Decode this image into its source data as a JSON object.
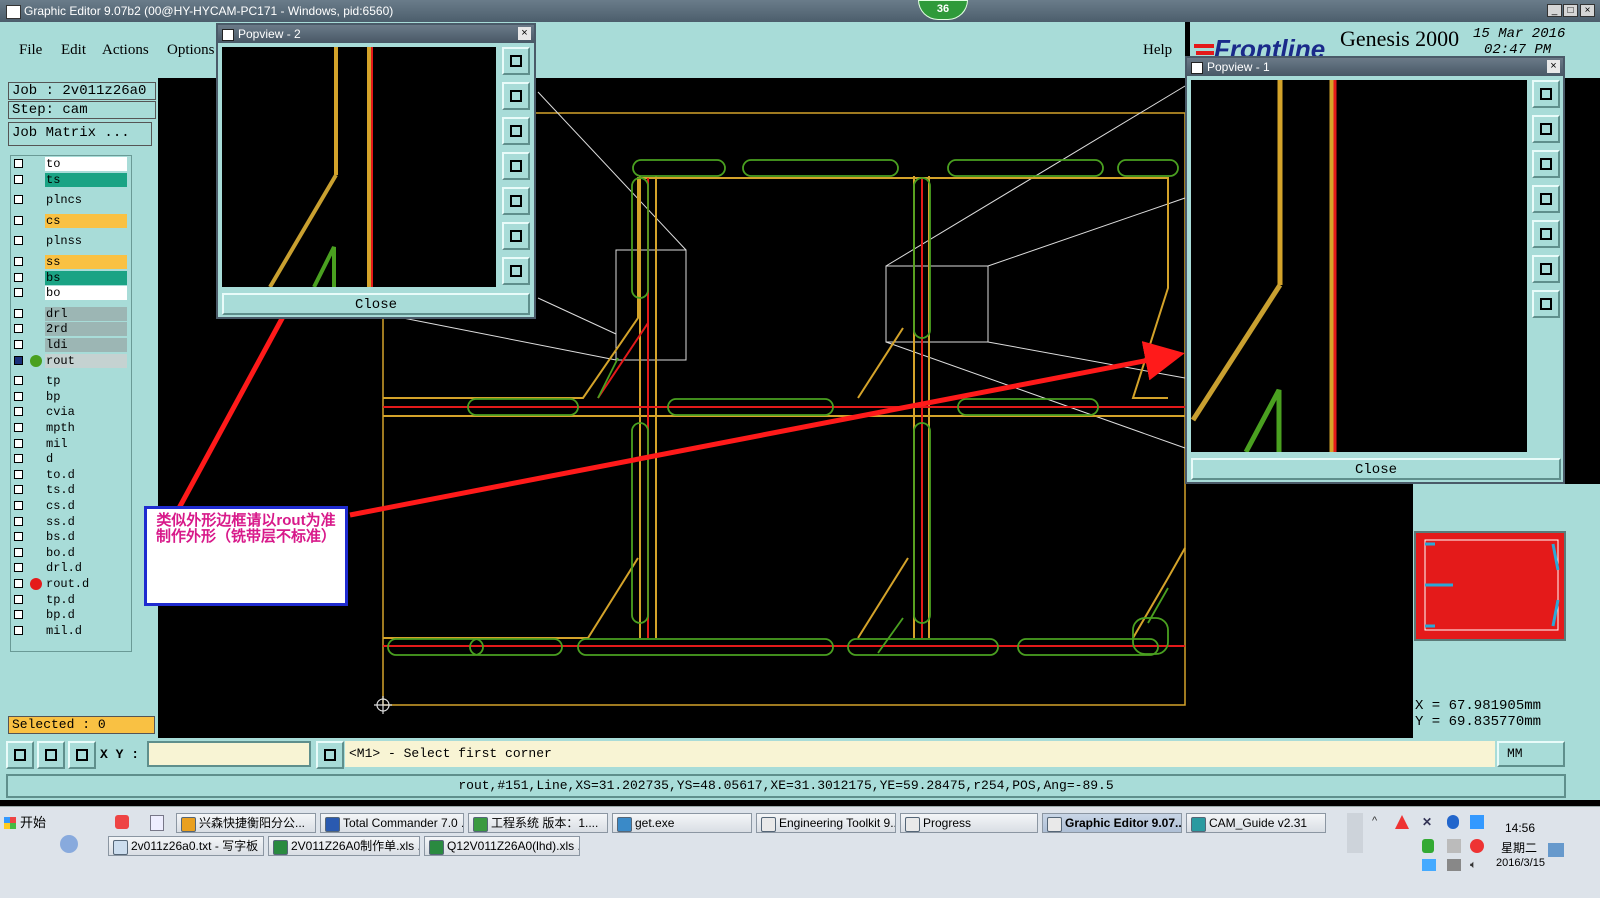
{
  "window": {
    "title": "Graphic Editor 9.07b2 (00@HY-HYCAM-PC171 - Windows, pid:6560)",
    "badge": "36",
    "min_glyph": "_",
    "max_glyph": "□",
    "close_glyph": "×"
  },
  "menu": {
    "file": "File",
    "edit": "Edit",
    "actions": "Actions",
    "options": "Options",
    "help": "Help"
  },
  "brand": {
    "logo": "Frontline",
    "product": "Genesis 2000",
    "date": "15 Mar 2016",
    "time": "02:47 PM"
  },
  "job": {
    "job_label": "Job : 2v011z26a0",
    "step_label": "Step: cam",
    "matrix_button": "Job Matrix ..."
  },
  "layers": [
    {
      "name": "to",
      "color": "#ffffff"
    },
    {
      "name": "ts",
      "color": "#1aa384"
    },
    {
      "name": "plncs",
      "color": "#a8dcd8"
    },
    {
      "name": "cs",
      "color": "#f9c143"
    },
    {
      "name": "plnss",
      "color": "#a8dcd8"
    },
    {
      "name": "ss",
      "color": "#f9c143"
    },
    {
      "name": "bs",
      "color": "#1aa384"
    },
    {
      "name": "bo",
      "color": "#ffffff"
    },
    {
      "name": "drl",
      "color": "#9cb6b4"
    },
    {
      "name": "2rd",
      "color": "#9cb6b4"
    },
    {
      "name": "ldi",
      "color": "#9cb6b4"
    },
    {
      "name": "rout",
      "color": "#c5d2d1"
    },
    {
      "name": "tp",
      "color": "#a8dcd8"
    },
    {
      "name": "bp",
      "color": "#a8dcd8"
    },
    {
      "name": "cvia",
      "color": "#a8dcd8"
    },
    {
      "name": "mpth",
      "color": "#a8dcd8"
    },
    {
      "name": "mil",
      "color": "#a8dcd8"
    },
    {
      "name": "d",
      "color": "#a8dcd8"
    },
    {
      "name": "to.d",
      "color": "#a8dcd8"
    },
    {
      "name": "ts.d",
      "color": "#a8dcd8"
    },
    {
      "name": "cs.d",
      "color": "#a8dcd8"
    },
    {
      "name": "ss.d",
      "color": "#a8dcd8"
    },
    {
      "name": "bs.d",
      "color": "#a8dcd8"
    },
    {
      "name": "bo.d",
      "color": "#a8dcd8"
    },
    {
      "name": "drl.d",
      "color": "#a8dcd8"
    },
    {
      "name": "rout.d",
      "color": "#a8dcd8"
    },
    {
      "name": "tp.d",
      "color": "#a8dcd8"
    },
    {
      "name": "bp.d",
      "color": "#a8dcd8"
    },
    {
      "name": "mil.d",
      "color": "#a8dcd8"
    }
  ],
  "selected": "Selected : 0",
  "popview2": {
    "title": "Popview - 2",
    "close": "Close"
  },
  "popview1": {
    "title": "Popview - 1",
    "close": "Close"
  },
  "annotation": "类似外形边框请以rout为准制作外形（铣带层不标准）",
  "coords": {
    "x": "X = 67.981905mm",
    "y": "Y = 69.835770mm"
  },
  "command": {
    "xy_label": "X Y :",
    "prompt": "<M1> - Select first corner",
    "units": "MM"
  },
  "status": "rout,#151,Line,XS=31.202735,YS=48.05617,XE=31.3012175,YE=59.28475,r254,POS,Ang=-89.5",
  "taskbar": {
    "start": "开始",
    "row1": [
      "兴森快捷衡阳分公...",
      "Total Commander 7.0 ...",
      "工程系统  版本：1....",
      "get.exe",
      "Engineering Toolkit 9....",
      "Progress",
      "Graphic Editor 9.07...",
      "CAM_Guide v2.31"
    ],
    "row2": [
      "2v011z26a0.txt - 写字板",
      "2V011Z26A0制作单.xls ...",
      "Q12V011Z26A0(lhd).xls ..."
    ],
    "clock_time": "14:56",
    "clock_day": "星期二",
    "clock_date": "2016/3/15"
  },
  "colors": {
    "panel": "#a8dcd8",
    "outline": "#d4a32a",
    "rout": "#e41a1a",
    "green": "#4aa020",
    "arrow": "#ff1a1a"
  }
}
